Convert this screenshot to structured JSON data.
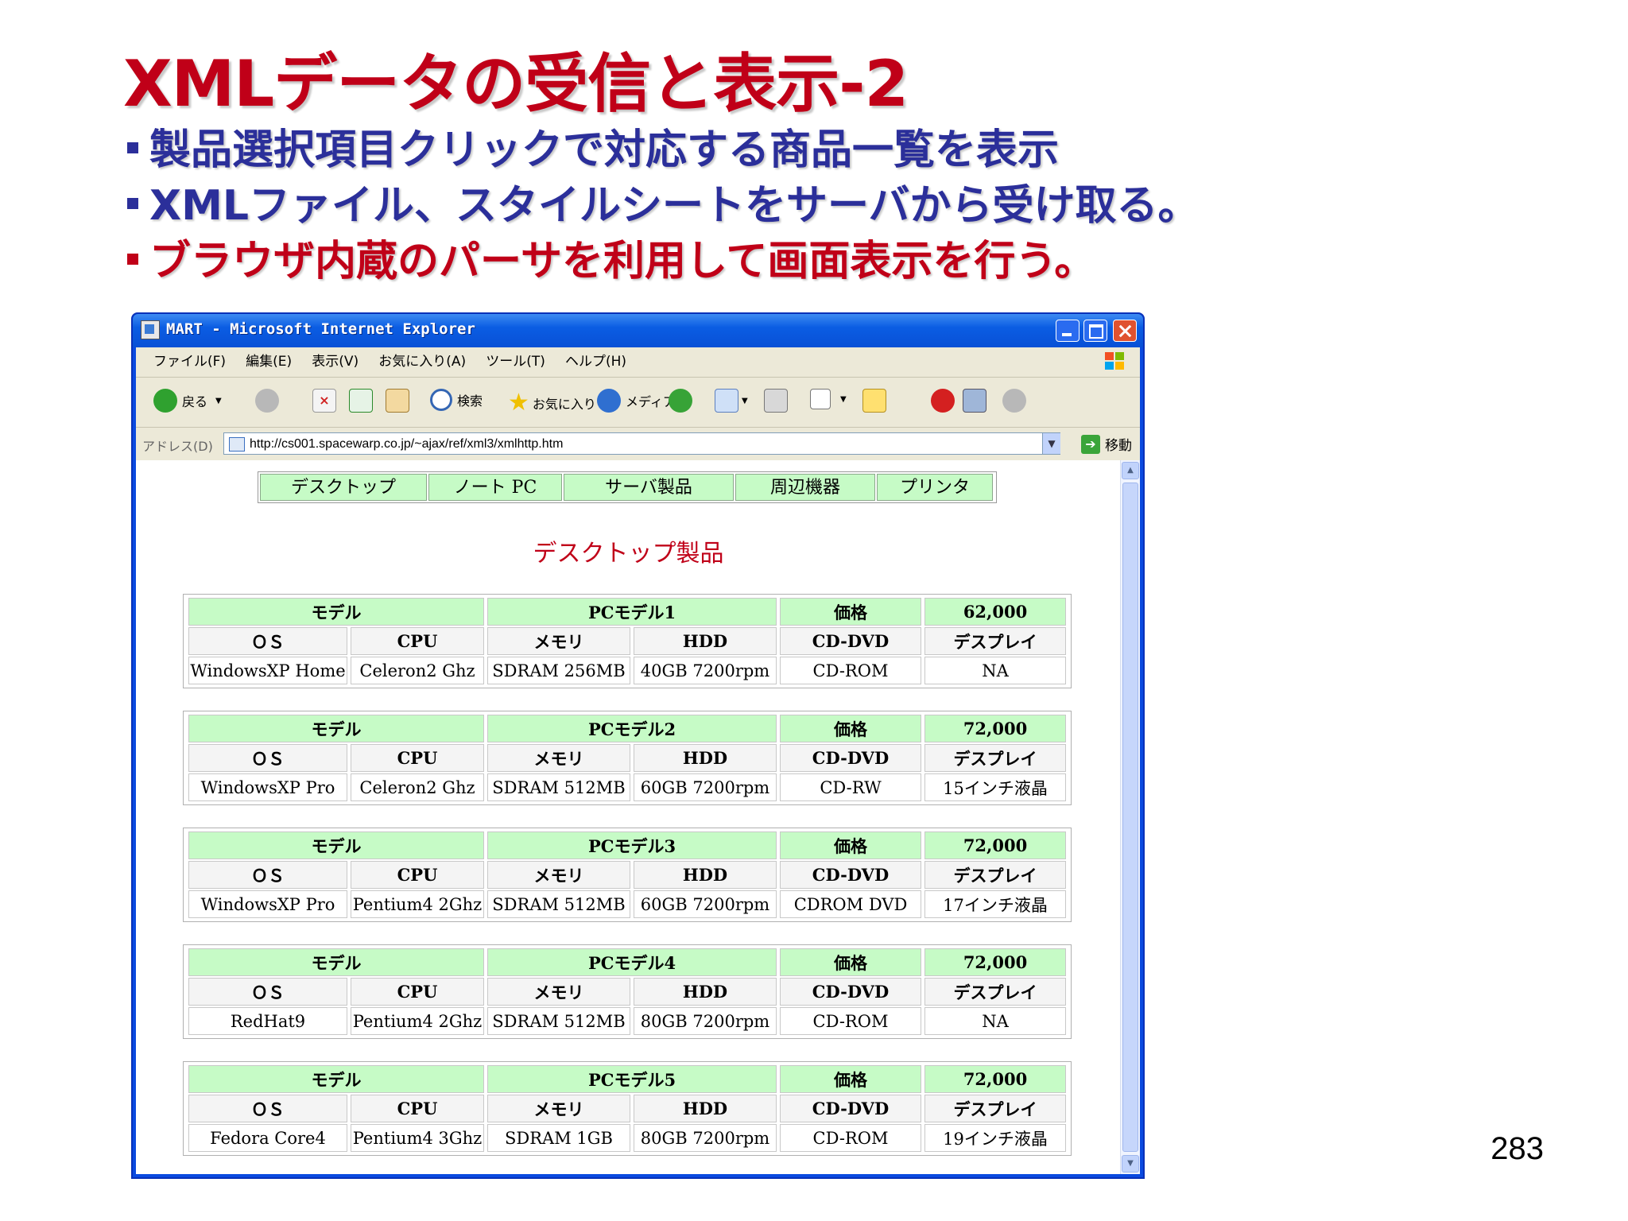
{
  "slide": {
    "title": "XMLデータの受信と表示-2",
    "bullets": [
      "製品選択項目クリックで対応する商品一覧を表示",
      "XMLファイル、スタイルシートをサーバから受け取る。",
      "ブラウザ内蔵のパーサを利用して画面表示を行う。"
    ],
    "page_number": "283"
  },
  "window": {
    "title": "MART - Microsoft Internet Explorer"
  },
  "menu": [
    "ファイル(F)",
    "編集(E)",
    "表示(V)",
    "お気に入り(A)",
    "ツール(T)",
    "ヘルプ(H)"
  ],
  "toolbar": {
    "back": "戻る",
    "search": "検索",
    "favorites": "お気に入り",
    "media": "メディア"
  },
  "address": {
    "label": "アドレス(D)",
    "url": "http://cs001.spacewarp.co.jp/~ajax/ref/xml3/xmlhttp.htm",
    "go": "移動"
  },
  "nav": [
    "デスクトップ",
    "ノート PC",
    "サーバ製品",
    "周辺機器",
    "プリンタ"
  ],
  "section_title": "デスクトップ製品",
  "headers": {
    "model": "モデル",
    "price": "価格",
    "os": "ＯＳ",
    "cpu": "CPU",
    "memory": "メモリ",
    "hdd": "HDD",
    "drive": "CD-DVD",
    "display": "デスプレイ"
  },
  "products": [
    {
      "model": "PCモデル1",
      "price": "62,000",
      "os": "WindowsXP Home",
      "cpu": "Celeron2 Ghz",
      "memory": "SDRAM 256MB",
      "hdd": "40GB 7200rpm",
      "drive": "CD-ROM",
      "display": "NA"
    },
    {
      "model": "PCモデル2",
      "price": "72,000",
      "os": "WindowsXP Pro",
      "cpu": "Celeron2 Ghz",
      "memory": "SDRAM 512MB",
      "hdd": "60GB 7200rpm",
      "drive": "CD-RW",
      "display": "15インチ液晶"
    },
    {
      "model": "PCモデル3",
      "price": "72,000",
      "os": "WindowsXP Pro",
      "cpu": "Pentium4 2Ghz",
      "memory": "SDRAM 512MB",
      "hdd": "60GB 7200rpm",
      "drive": "CDROM DVD",
      "display": "17インチ液晶"
    },
    {
      "model": "PCモデル4",
      "price": "72,000",
      "os": "RedHat9",
      "cpu": "Pentium4 2Ghz",
      "memory": "SDRAM 512MB",
      "hdd": "80GB 7200rpm",
      "drive": "CD-ROM",
      "display": "NA"
    },
    {
      "model": "PCモデル5",
      "price": "72,000",
      "os": "Fedora Core4",
      "cpu": "Pentium4 3Ghz",
      "memory": "SDRAM 1GB",
      "hdd": "80GB 7200rpm",
      "drive": "CD-ROM",
      "display": "19インチ液晶"
    }
  ],
  "colors": {
    "title_red": "#c00018",
    "bullet_blue": "#2b2f9a",
    "header_green": "#c6fbc6",
    "xp_blue": "#0a4ae0"
  },
  "icons": [
    "back-arrow-icon",
    "forward-arrow-icon",
    "stop-icon",
    "refresh-icon",
    "home-icon",
    "search-icon",
    "favorites-star-icon",
    "media-globe-icon",
    "history-icon",
    "mail-icon",
    "print-icon",
    "edit-icon",
    "folder-icon",
    "power-icon",
    "messenger-icon",
    "discuss-icon"
  ]
}
